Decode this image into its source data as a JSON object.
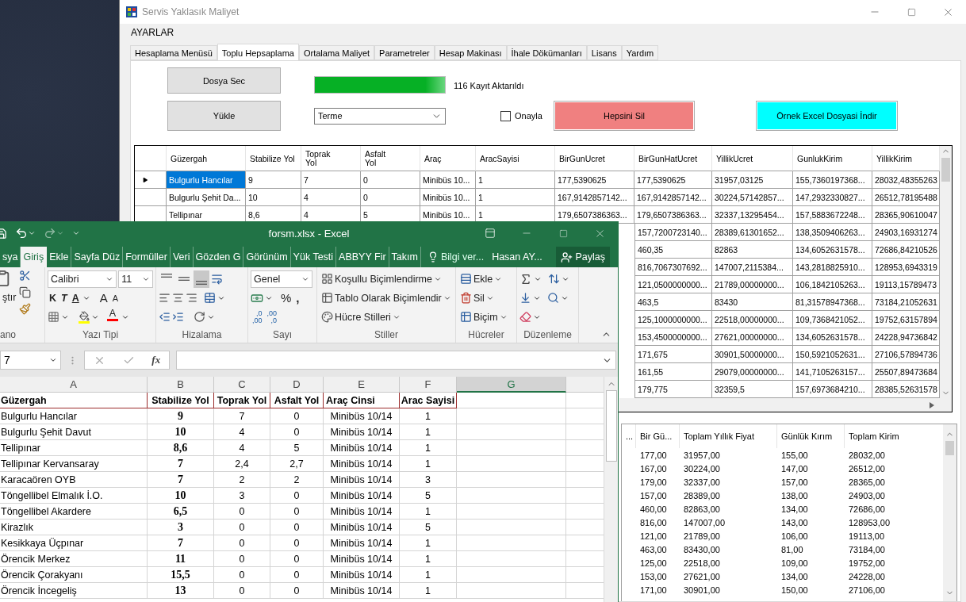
{
  "app": {
    "title": "Servis Yaklasık Maliyet",
    "menu": [
      "AYARLAR"
    ],
    "tabs": [
      {
        "label": "Hesaplama Menüsü",
        "selected": false
      },
      {
        "label": "Toplu Hepsaplama",
        "selected": true
      },
      {
        "label": "Ortalama Maliyet",
        "selected": false
      },
      {
        "label": "Parametreler",
        "selected": false
      },
      {
        "label": "Hesap Makinası",
        "selected": false
      },
      {
        "label": "İhale Dökümanları",
        "selected": false
      },
      {
        "label": "Lisans",
        "selected": false
      },
      {
        "label": "Yardım",
        "selected": false
      }
    ],
    "select_file_button": "Dosya Sec",
    "load_button": "Yükle",
    "progress": {
      "level": 1,
      "status": "116 Kayıt Aktarıldı"
    },
    "district_select": {
      "value": "Terme"
    },
    "confirm_checkbox": {
      "label": "Onayla",
      "checked": false
    },
    "delete_all_button": "Hepsini Sil",
    "download_sample_button": "Örnek Excel Dosyasi İndir",
    "grid": {
      "columns": [
        "Güzergah",
        "Stabilize Yol",
        "Toprak Yol",
        "Asfalt Yol",
        "Araç",
        "AracSayisi",
        "BirGunUcret",
        "BirGunHatUcret",
        "YillikUcret",
        "GunlukKirim",
        "YillikKirim"
      ],
      "rows": [
        {
          "selected": true,
          "cells": [
            "Bulgurlu Hancılar",
            "9",
            "7",
            "0",
            "Minibüs 10...",
            "1",
            "177,5390625",
            "177,5390625",
            "31957,03125",
            "155,7360197368...",
            "28032,48355263"
          ]
        },
        {
          "selected": false,
          "cells": [
            "Bulgurlu Şehit Da...",
            "10",
            "4",
            "0",
            "Minibüs 10...",
            "1",
            "167,9142857142...",
            "167,9142857142...",
            "30224,57142857...",
            "147,2932330827...",
            "26512,78195488"
          ]
        },
        {
          "selected": false,
          "cells": [
            "Tellipınar",
            "8,6",
            "4",
            "5",
            "Minibüs 10...",
            "1",
            "179,6507386363...",
            "179,6507386363...",
            "32337,13295454...",
            "157,5883672248...",
            "28365,90610047"
          ]
        },
        {
          "cells": [
            "157,7200723140...",
            "28389,61301652...",
            "138,3509406263...",
            "24903,16931274"
          ]
        },
        {
          "cells": [
            "460,35",
            "82863",
            "134,6052631578...",
            "72686,84210526"
          ]
        },
        {
          "cells": [
            "816,7067307692...",
            "147007,2115384...",
            "143,2818825910...",
            "128953,6943319"
          ]
        },
        {
          "cells": [
            "121,0500000000...",
            "21789,00000000...",
            "106,1842105263...",
            "19113,15789473"
          ]
        },
        {
          "cells": [
            "463,5",
            "83430",
            "81,31578947368...",
            "73184,21052631"
          ]
        },
        {
          "cells": [
            "125,1000000000...",
            "22518,00000000...",
            "109,7368421052...",
            "19752,63157894"
          ]
        },
        {
          "cells": [
            "153,4500000000...",
            "27621,00000000...",
            "134,6052631578...",
            "24228,94736842"
          ]
        },
        {
          "cells": [
            "171,675",
            "30901,50000000...",
            "150,5921052631...",
            "27106,57894736"
          ]
        },
        {
          "cells": [
            "161,55",
            "29079,00000000...",
            "141,7105263157...",
            "25507,89473684"
          ]
        },
        {
          "cells": [
            "179,775",
            "32359,5",
            "157,6973684210...",
            "28385,52631578"
          ]
        }
      ]
    },
    "summary_grid": {
      "columns": [
        "...",
        "Bir Gü...",
        "Toplam Yıllık Fiyat",
        "Günlük Kırım",
        "Toplam Kirim"
      ],
      "rows": [
        [
          "",
          "177,00",
          "31957,00",
          "155,00",
          "28032,00"
        ],
        [
          "",
          "167,00",
          "30224,00",
          "147,00",
          "26512,00"
        ],
        [
          "",
          "179,00",
          "32337,00",
          "157,00",
          "28365,00"
        ],
        [
          "",
          "157,00",
          "28389,00",
          "138,00",
          "24903,00"
        ],
        [
          "",
          "460,00",
          "82863,00",
          "134,00",
          "72686,00"
        ],
        [
          "",
          "816,00",
          "147007,00",
          "143,00",
          "128953,00"
        ],
        [
          "",
          "121,00",
          "21789,00",
          "106,00",
          "19113,00"
        ],
        [
          "",
          "463,00",
          "83430,00",
          "81,00",
          "73184,00"
        ],
        [
          "",
          "125,00",
          "22518,00",
          "109,00",
          "19752,00"
        ],
        [
          "",
          "153,00",
          "27621,00",
          "134,00",
          "24228,00"
        ],
        [
          "",
          "171,00",
          "30901,00",
          "150,00",
          "27106,00"
        ]
      ]
    }
  },
  "excel": {
    "title": "forsm.xlsx - Excel",
    "tabs": [
      {
        "label": "sya",
        "selected": false
      },
      {
        "label": "Giriş",
        "selected": true
      },
      {
        "label": "Ekle",
        "selected": false
      },
      {
        "label": "Sayfa Düz",
        "selected": false
      },
      {
        "label": "Formüller",
        "selected": false
      },
      {
        "label": "Veri",
        "selected": false
      },
      {
        "label": "Gözden G",
        "selected": false
      },
      {
        "label": "Görünüm",
        "selected": false
      },
      {
        "label": "Yük Testi",
        "selected": false
      },
      {
        "label": "ABBYY Fir",
        "selected": false
      },
      {
        "label": "Takım",
        "selected": false
      }
    ],
    "tell_me": "Bilgi ver...",
    "user": "Hasan AY...",
    "share": "Paylaş",
    "ribbon": {
      "paste_label": "ştır",
      "font_name": "Calibri",
      "font_size": "11",
      "bold": "K",
      "italic": "T",
      "underline": "A",
      "grow_font": "A",
      "shrink_font": "A",
      "font_color": "A",
      "vertical_align": [
        {
          "selected": false
        },
        {
          "selected": false
        },
        {
          "selected": true
        }
      ],
      "number_format": "Genel",
      "percent": "%",
      "comma": ",",
      "increase_decimal": [
        ",0",
        ",00"
      ],
      "decrease_decimal": [
        ",00",
        ",0"
      ],
      "styles": [
        "Koşullu Biçimlendirme",
        "Tablo Olarak Biçimlendir",
        "Hücre Stilleri"
      ],
      "cells": [
        "Ekle",
        "Sil",
        "Biçim"
      ],
      "groups": [
        "ano",
        "Yazı Tipi",
        "Hizalama",
        "Sayı",
        "Stiller",
        "Hücreler",
        "Düzenleme"
      ]
    },
    "name_box": "7",
    "fx": "fx",
    "sheet": {
      "columns": [
        {
          "label": "A",
          "selected": false
        },
        {
          "label": "B",
          "selected": false
        },
        {
          "label": "C",
          "selected": false
        },
        {
          "label": "D",
          "selected": false
        },
        {
          "label": "E",
          "selected": false
        },
        {
          "label": "F",
          "selected": false
        },
        {
          "label": "G",
          "selected": true
        }
      ],
      "header_row": [
        "Güzergah",
        "Stabilize Yol",
        "Toprak Yol",
        "Asfalt Yol",
        "Araç Cinsi",
        "Arac Sayisi"
      ],
      "rows": [
        [
          "Bulgurlu Hancılar",
          "9",
          "7",
          "0",
          "Minibüs 10/14",
          "1"
        ],
        [
          "Bulgurlu Şehit Davut",
          "10",
          "4",
          "0",
          "Minibüs 10/14",
          "1"
        ],
        [
          "Tellipınar",
          "8,6",
          "4",
          "5",
          "Minibüs 10/14",
          "1"
        ],
        [
          "Tellipınar Kervansaray",
          "7",
          "2,4",
          "2,7",
          "Minibüs 10/14",
          "1"
        ],
        [
          "Karacaören OYB",
          "7",
          "2",
          "2",
          "Minibüs 10/14",
          "3"
        ],
        [
          "Töngellibel Elmalık İ.O.",
          "10",
          "3",
          "0",
          "Minibüs 10/14",
          "5"
        ],
        [
          "Töngellibel Akardere",
          "6,5",
          "0",
          "0",
          "Minibüs 10/14",
          "1"
        ],
        [
          "Kirazlık",
          "3",
          "0",
          "0",
          "Minibüs 10/14",
          "5"
        ],
        [
          "Kesikkaya Üçpınar",
          "7",
          "0",
          "0",
          "Minibüs 10/14",
          "1"
        ],
        [
          "Örencik Merkez",
          "11",
          "0",
          "0",
          "Minibüs 10/14",
          "1"
        ],
        [
          "Örencik Çorakyanı",
          "15,5",
          "0",
          "0",
          "Minibüs 10/14",
          "1"
        ],
        [
          "Örencik İncegeliş",
          "13",
          "0",
          "0",
          "Minibüs 10/14",
          "1"
        ]
      ]
    }
  }
}
